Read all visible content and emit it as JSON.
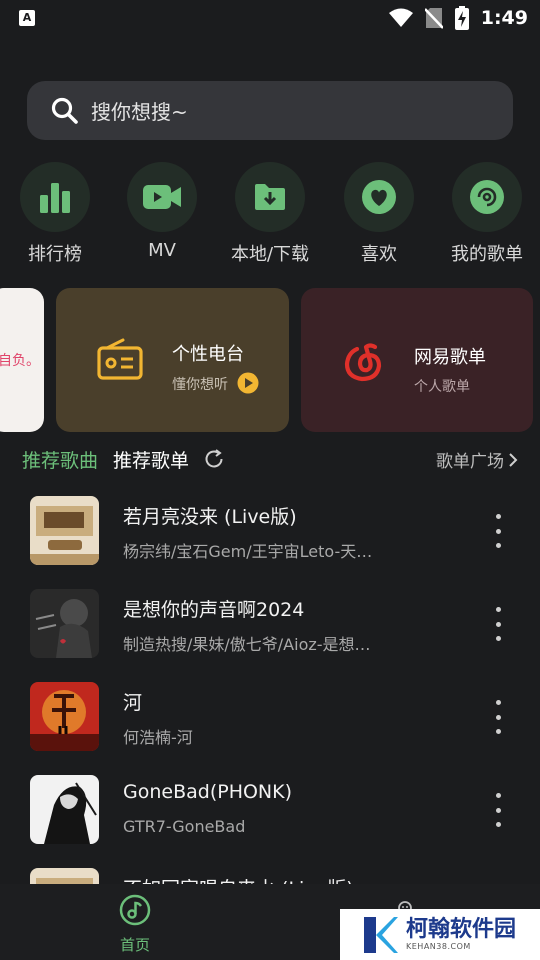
{
  "status_bar": {
    "time": "1:49",
    "app_badge": "A"
  },
  "search": {
    "placeholder": "搜你想搜~"
  },
  "quick_actions": [
    {
      "label": "排行榜",
      "icon": "bar-chart-icon"
    },
    {
      "label": "MV",
      "icon": "video-camera-icon"
    },
    {
      "label": "本地/下载",
      "icon": "folder-download-icon"
    },
    {
      "label": "喜欢",
      "icon": "heart-icon"
    },
    {
      "label": "我的歌单",
      "icon": "disc-icon"
    }
  ],
  "cards": {
    "partial_text": "自负。",
    "radio": {
      "title": "个性电台",
      "subtitle": "懂你想听"
    },
    "netease": {
      "title": "网易歌单",
      "subtitle": "个人歌单"
    }
  },
  "section": {
    "tab_songs": "推荐歌曲",
    "tab_playlists": "推荐歌单",
    "more": "歌单广场"
  },
  "songs": [
    {
      "title": "若月亮没来 (Live版)",
      "subtitle": "杨宗纬/宝石Gem/王宇宙Leto-天…"
    },
    {
      "title": "是想你的声音啊2024",
      "subtitle": "制造热搜/果妹/傲七爷/Aioz-是想…"
    },
    {
      "title": "河",
      "subtitle": "何浩楠-河"
    },
    {
      "title": "GoneBad(PHONK)",
      "subtitle": "GTR7-GoneBad"
    },
    {
      "title": "不如回家唱自来水 (Live版)",
      "subtitle": ""
    }
  ],
  "bottom_nav": {
    "home": "首页"
  },
  "watermark": {
    "name": "柯翰软件园",
    "url": "KEHAN38.COM"
  },
  "colors": {
    "accent": "#6cbf7a",
    "background": "#1b1c1e",
    "radio_card": "#4a3f2b",
    "netease_card": "#3a2226",
    "netease_red": "#e0302a",
    "radio_yellow": "#f2b632"
  }
}
